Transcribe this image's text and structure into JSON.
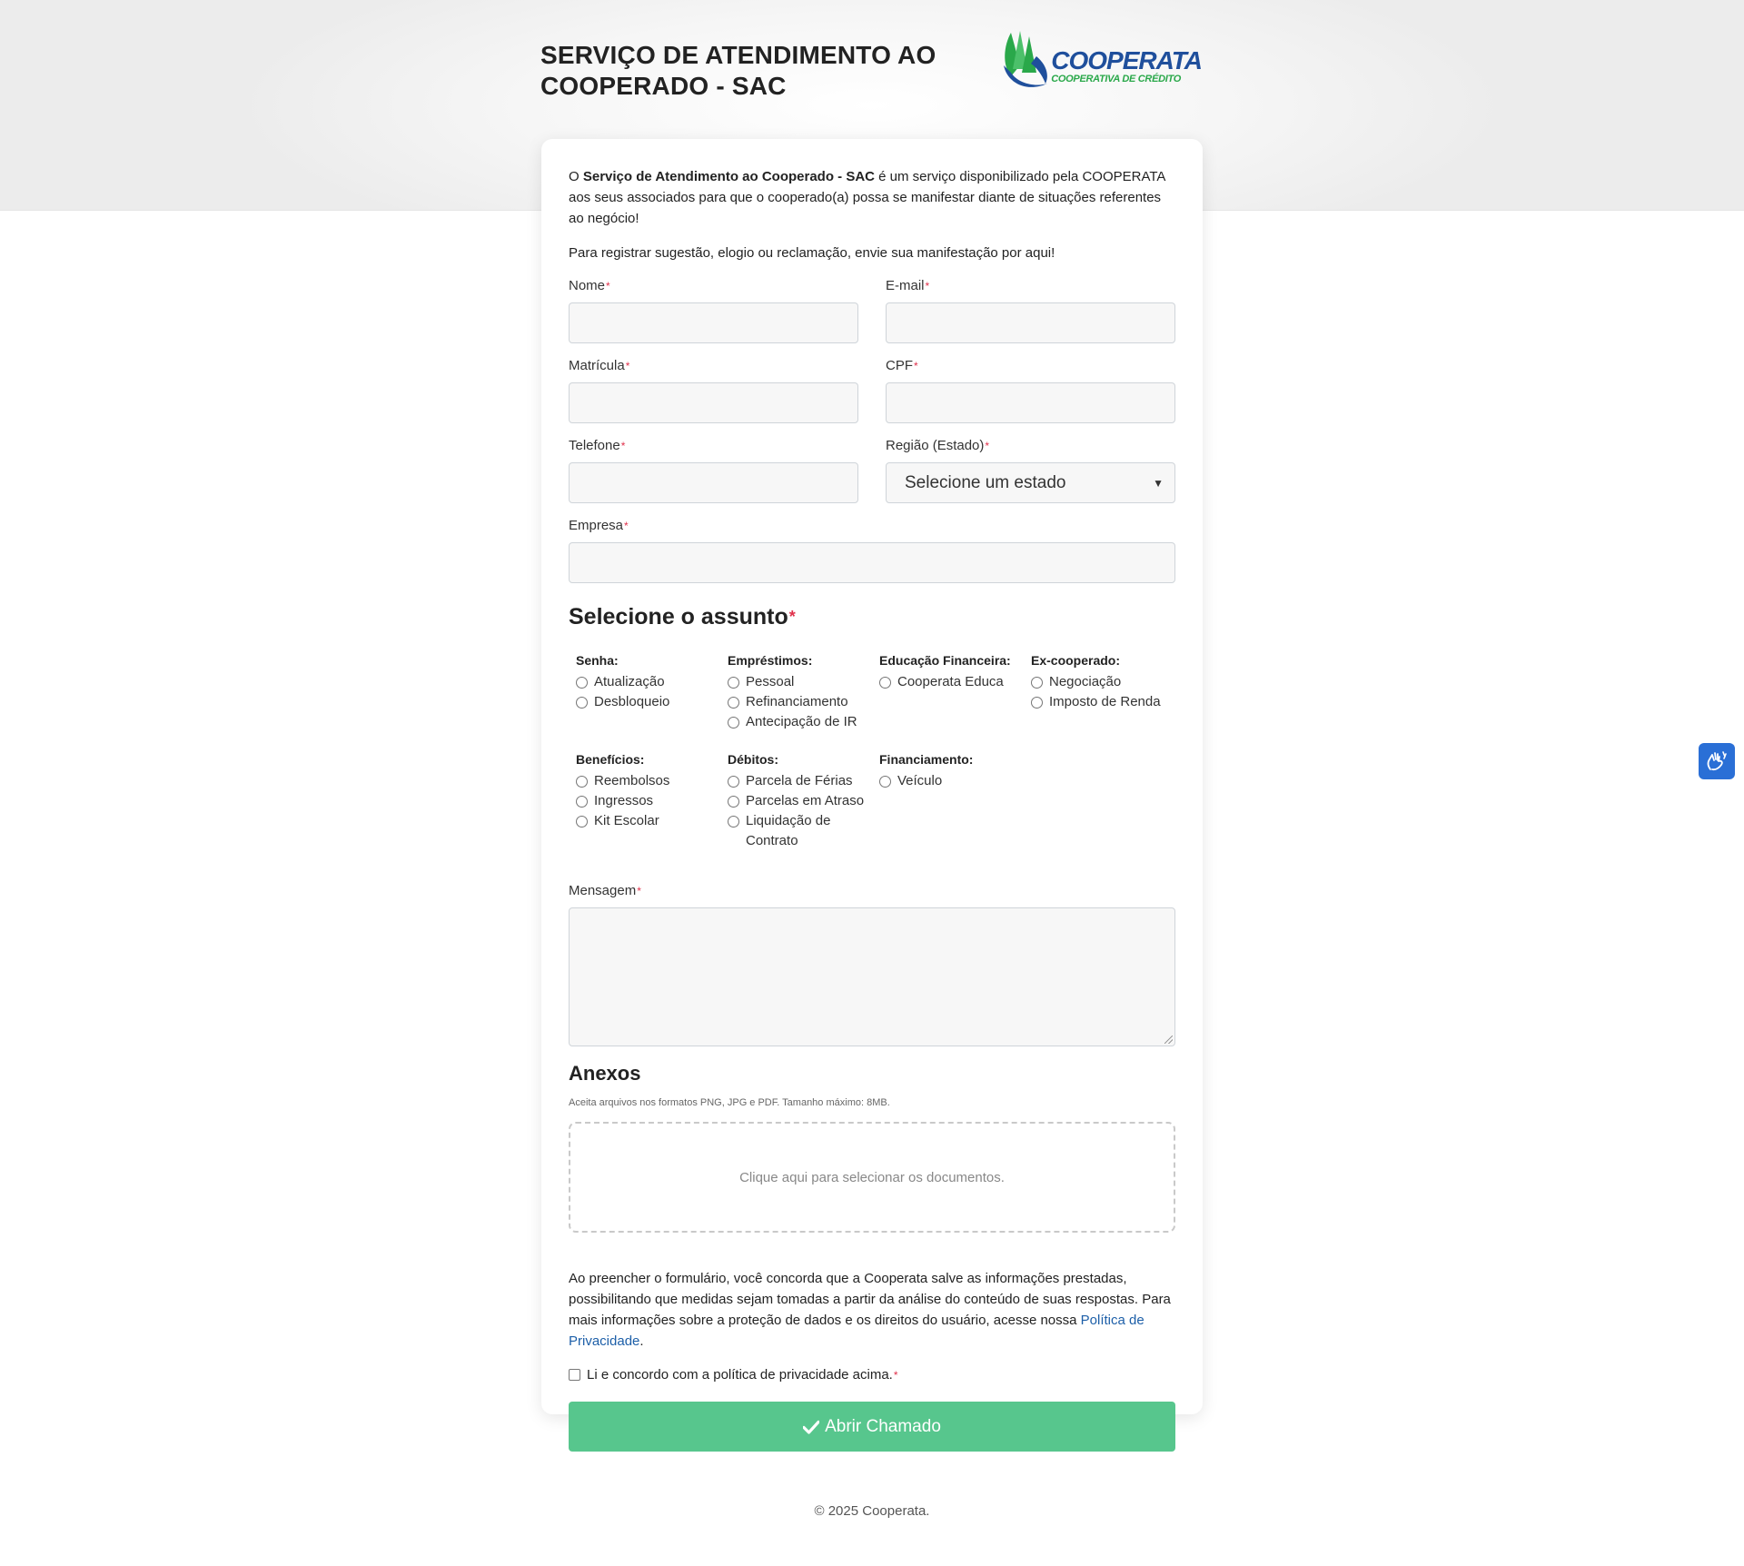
{
  "header": {
    "title": "SERVIÇO DE ATENDIMENTO AO COOPERADO - SAC",
    "logo_name": "COOPERATA",
    "logo_sub": "COOPERATIVA DE CRÉDITO"
  },
  "intro": {
    "prefix": "O ",
    "bold": "Serviço de Atendimento ao Cooperado - SAC",
    "suffix": " é um serviço disponibilizado pela COOPERATA aos seus associados para que o cooperado(a) possa se manifestar diante de situações referentes ao negócio!",
    "line2": "Para registrar sugestão, elogio ou reclamação, envie sua manifestação por aqui!"
  },
  "required_mark": "*",
  "fields": {
    "nome": "Nome",
    "email": "E-mail",
    "matricula": "Matrícula",
    "cpf": "CPF",
    "telefone": "Telefone",
    "regiao": "Região (Estado)",
    "regiao_selected": "Selecione um estado",
    "empresa": "Empresa",
    "mensagem": "Mensagem"
  },
  "subject": {
    "title": "Selecione o assunto",
    "categories": [
      {
        "title": "Senha:",
        "options": [
          "Atualização",
          "Desbloqueio"
        ]
      },
      {
        "title": "Empréstimos:",
        "options": [
          "Pessoal",
          "Refinanciamento",
          "Antecipação de IR"
        ]
      },
      {
        "title": "Educação Financeira:",
        "options": [
          "Cooperata Educa"
        ]
      },
      {
        "title": "Ex-cooperado:",
        "options": [
          "Negociação",
          "Imposto de Renda"
        ]
      },
      {
        "title": "Benefícios:",
        "options": [
          "Reembolsos",
          "Ingressos",
          "Kit Escolar"
        ]
      },
      {
        "title": "Débitos:",
        "options": [
          "Parcela de Férias",
          "Parcelas em Atraso",
          "Liquidação de Contrato"
        ]
      },
      {
        "title": "Financiamento:",
        "options": [
          "Veículo"
        ]
      }
    ]
  },
  "anexos": {
    "title": "Anexos",
    "hint": "Aceita arquivos nos formatos PNG, JPG e PDF. Tamanho máximo: 8MB.",
    "dropzone": "Clique aqui para selecionar os documentos."
  },
  "policy": {
    "text": "Ao preencher o formulário, você concorda que a Cooperata salve as informações prestadas, possibilitando que medidas sejam tomadas a partir da análise do conteúdo de suas respostas. Para mais informações sobre a proteção de dados e os direitos do usuário, acesse nossa ",
    "link": "Política de Privacidade",
    "end": ".",
    "agree": "Li e concordo com a política de privacidade acima."
  },
  "submit_label": "Abrir Chamado",
  "footer": "© 2025 Cooperata.",
  "icons": {
    "submit": "check-icon",
    "accessibility": "sign-language-hands-icon",
    "logo": "cooperata-tree-logo-icon"
  },
  "colors": {
    "submit_bg": "#57c68d",
    "logo_blue": "#1f4f9c",
    "logo_green": "#2aa84a",
    "required": "#e0314b",
    "link": "#1d5fa8",
    "a11y_button": "#2a6fd6"
  }
}
